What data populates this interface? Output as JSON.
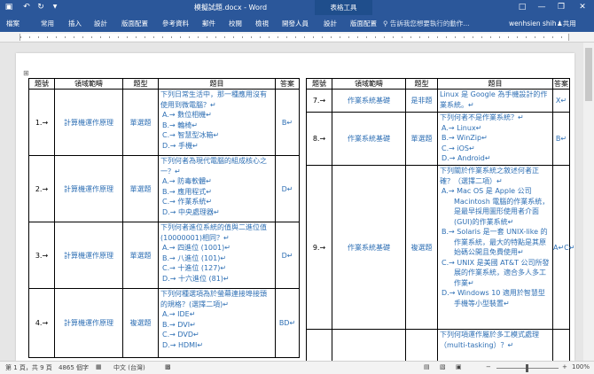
{
  "titlebar": {
    "doc_title": "模擬試題.docx - Word",
    "context_tab": "表格工具",
    "save_icon": "save-icon",
    "undo_icon": "undo-icon",
    "redo_icon": "redo-icon",
    "options_glyph": "▼"
  },
  "ribbon": {
    "tabs": [
      "檔案",
      "常用",
      "插入",
      "設計",
      "版面配置",
      "參考資料",
      "郵件",
      "校閱",
      "檢視",
      "開發人員",
      "設計",
      "版面配置"
    ],
    "tell_me": "告訴我您想要執行的動作...",
    "user": "wenhsien shih",
    "share": "共用"
  },
  "left_table": {
    "headers": [
      "題號",
      "領域範疇",
      "題型",
      "題目",
      "答案"
    ],
    "rows": [
      {
        "num": "1.→",
        "domain": "計算機運作原理",
        "type": "單選題",
        "stem": "下列日常生活中，那一種應用沒有使用到微電腦？↵",
        "options": [
          "A.→ 數位相機↵",
          "B.→ 輪椅↵",
          "C.→ 智慧型冰箱↵",
          "D.→ 手機↵"
        ],
        "answer": "B↵"
      },
      {
        "num": "2.→",
        "domain": "計算機運作原理",
        "type": "單選題",
        "stem": "下列何者為現代電腦的組成核心之一？↵",
        "options": [
          "A.→ 防毒軟體↵",
          "B.→ 應用程式↵",
          "C.→ 作業系統↵",
          "D.→ 中央處理器↵"
        ],
        "answer": "D↵"
      },
      {
        "num": "3.→",
        "domain": "計算機運作原理",
        "type": "單選題",
        "stem": "下列何者進位系統的值與二進位值(10000001)相同？↵",
        "options": [
          "A.→ 四進位 (1001)↵",
          "B.→ 八進位 (101)↵",
          "C.→ 十進位 (127)↵",
          "D.→ 十六進位 (81)↵"
        ],
        "answer": "D↵"
      },
      {
        "num": "4.→",
        "domain": "計算機運作原理",
        "type": "複選題",
        "stem": "下列何種選項為於螢幕連接埠接頭的規格？(選擇二項)↵",
        "options": [
          "A.→ IDE↵",
          "B.→ DVI↵",
          "C.→ DVD↵",
          "D.→ HDMI↵"
        ],
        "answer": "BD↵"
      }
    ]
  },
  "right_table": {
    "headers": [
      "題號",
      "領域範疇",
      "題型",
      "題目",
      "答案"
    ],
    "rows": [
      {
        "num": "7.→",
        "domain": "作業系統基礎",
        "type": "是非題",
        "stem": "Linux 是 Google 為手機設計的作業系統。↵",
        "options": [],
        "answer": "X↵"
      },
      {
        "num": "8.→",
        "domain": "作業系統基礎",
        "type": "單選題",
        "stem": "下列何者不是作業系統？↵",
        "options": [
          "A.→ Linux↵",
          "B.→ WinZip↵",
          "C.→ iOS↵",
          "D.→ Android↵"
        ],
        "answer": "B↵"
      },
      {
        "num": "9.→",
        "domain": "作業系統基礎",
        "type": "複選題",
        "stem": "下列關於作業系統之敘述何者正確？（選擇二項）↵",
        "options": [
          "A.→ Mac OS 是 Apple 公司 Macintosh 電腦的作業系統，是最早採用圖形使用者介面(GUI)的作業系統↵",
          "B.→ Solaris 是一套 UNIX-like 的作業系統，最大的特點是其原始碼公開且免費使用↵",
          "C.→ UNIX 是美國 AT&T 公司所發展的作業系統，適合多人多工作業↵",
          "D.→ Windows 10 適用於智慧型手機等小型裝置↵"
        ],
        "answer": "A↵C↵"
      },
      {
        "num": "",
        "domain": "",
        "type": "",
        "stem": "下列何項運作屬於多工模式處理（multi-tasking）？↵",
        "options": [],
        "answer": ""
      }
    ]
  },
  "statusbar": {
    "page": "第 1 頁，共 9 頁",
    "words": "4865 個字",
    "lang": "中文 (台灣)",
    "zoom": "100%"
  }
}
